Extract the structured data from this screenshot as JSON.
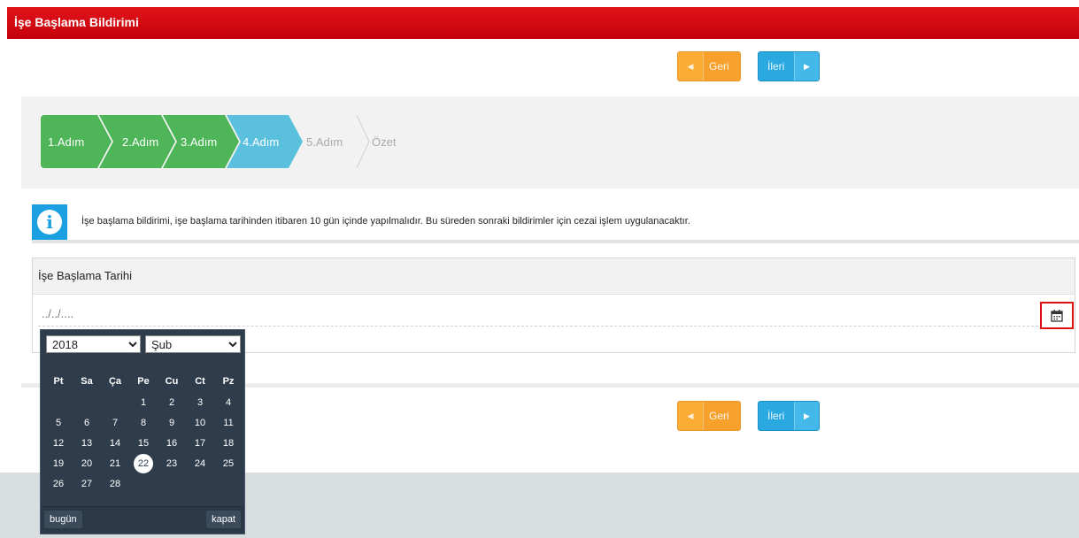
{
  "title": "İşe Başlama Bildirimi",
  "nav": {
    "back_label": "Geri",
    "next_label": "İleri"
  },
  "steps": [
    {
      "label": "1.Adım",
      "state": "done"
    },
    {
      "label": "2.Adım",
      "state": "done"
    },
    {
      "label": "3.Adım",
      "state": "done"
    },
    {
      "label": "4.Adım",
      "state": "active"
    },
    {
      "label": "5.Adım",
      "state": "pending"
    },
    {
      "label": "Özet",
      "state": "pending"
    }
  ],
  "info": {
    "text": "İşe başlama bildirimi, işe başlama tarihinden itibaren 10 gün içinde yapılmalıdır. Bu süreden sonraki bildirimler için cezai işlem uygulanacaktır."
  },
  "field": {
    "label": "İşe Başlama Tarihi",
    "placeholder": "../../...."
  },
  "calendar": {
    "year": "2018",
    "month": "Şub",
    "weekdays": [
      "Pt",
      "Sa",
      "Ça",
      "Pe",
      "Cu",
      "Ct",
      "Pz"
    ],
    "weeks": [
      [
        "",
        "",
        "",
        "1",
        "2",
        "3",
        "4"
      ],
      [
        "5",
        "6",
        "7",
        "8",
        "9",
        "10",
        "11"
      ],
      [
        "12",
        "13",
        "14",
        "15",
        "16",
        "17",
        "18"
      ],
      [
        "19",
        "20",
        "21",
        "22",
        "23",
        "24",
        "25"
      ],
      [
        "26",
        "27",
        "28",
        "",
        "",
        "",
        ""
      ]
    ],
    "today": "22",
    "today_label": "bugün",
    "close_label": "kapat"
  },
  "colors": {
    "header_red": "#d50d15",
    "step_done": "#4eb559",
    "step_active": "#5bc0de",
    "back_orange": "#fbac35",
    "next_blue": "#2aa9e0",
    "info_blue": "#1aa0e0",
    "calendar_bg": "#2e3c4b"
  },
  "icons": {
    "back_arrow": "caret-left-icon",
    "next_arrow": "caret-right-icon",
    "info": "info-icon",
    "calendar": "calendar-icon"
  }
}
